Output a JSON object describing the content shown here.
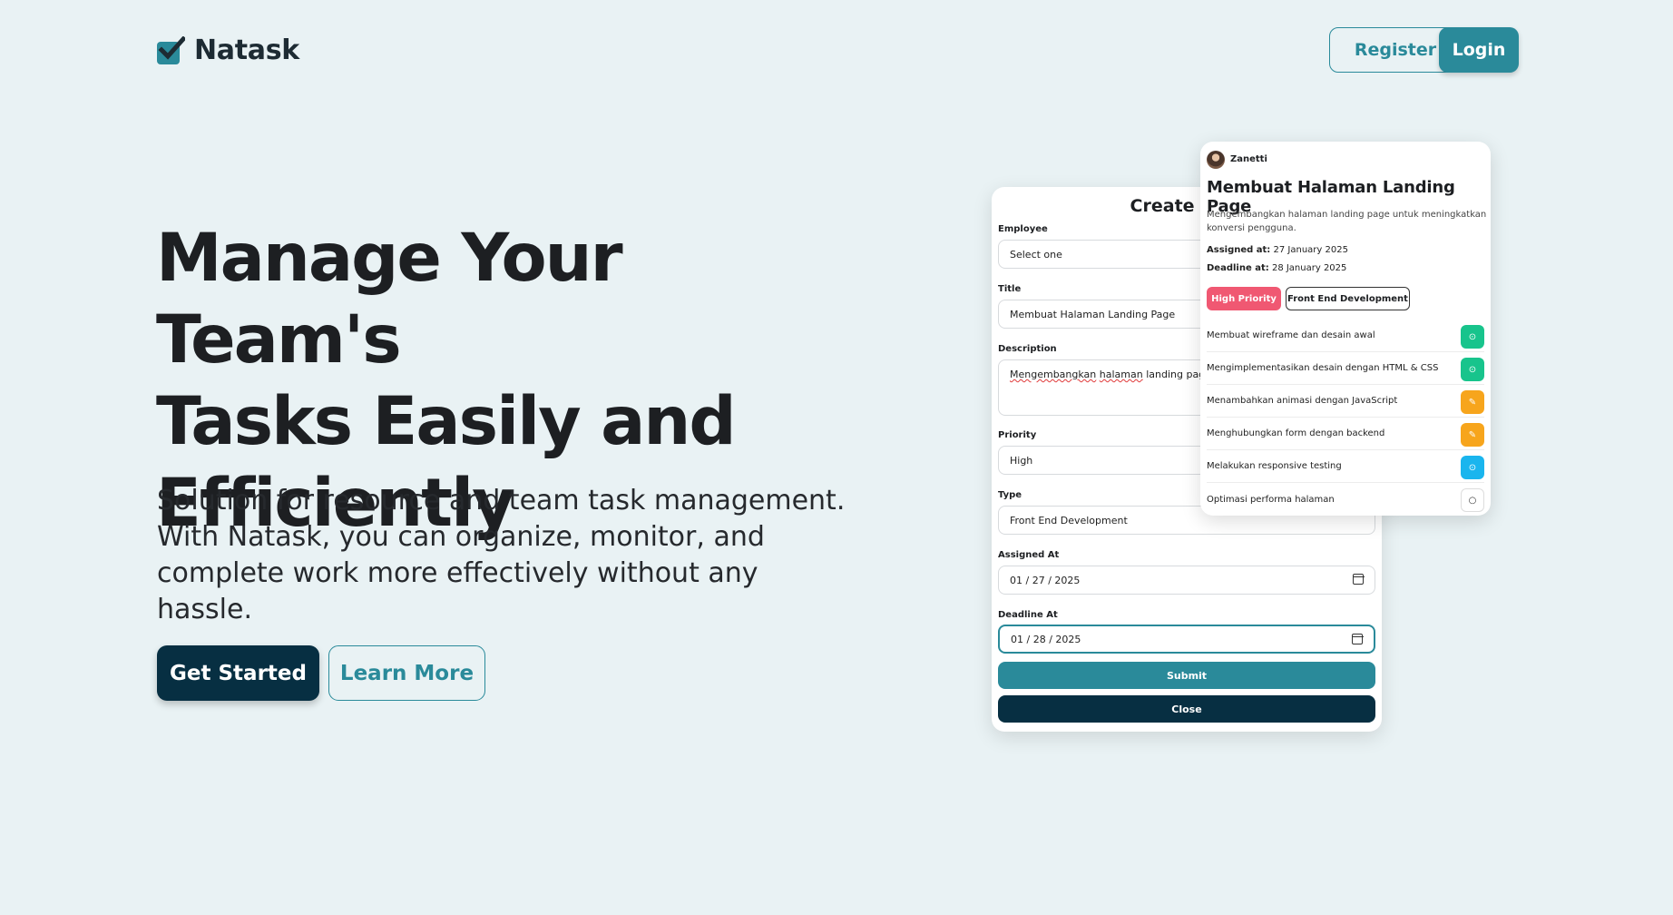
{
  "header": {
    "brand": "Natask",
    "register_label": "Register",
    "login_label": "Login"
  },
  "hero": {
    "title_lines": [
      "Manage Your Team's",
      "Tasks Easily and",
      "Efficiently"
    ],
    "subtitle_lines": [
      "Solution for resource and team task management.",
      "With Natask, you can organize, monitor, and",
      "complete work more effectively without any hassle."
    ],
    "get_started_label": "Get Started",
    "learn_more_label": "Learn More"
  },
  "form": {
    "title": "Create Task",
    "employee_label": "Employee",
    "employee_value": "Select one",
    "title_label": "Title",
    "title_value": "Membuat Halaman Landing Page",
    "description_label": "Description",
    "description_value_part1": "Mengembangkan",
    "description_value_part2": "halaman",
    "description_value_part3": "landing page untuk meningkatkan konversi pengguna.",
    "priority_label": "Priority",
    "priority_value": "High",
    "type_label": "Type",
    "type_value": "Front End Development",
    "assigned_label": "Assigned At",
    "assigned_value": "01 / 27 / 2025",
    "deadline_label": "Deadline At",
    "deadline_value": "01 / 28 / 2025",
    "submit_label": "Submit",
    "close_label": "Close"
  },
  "task": {
    "assignee": "Zanetti",
    "title": "Membuat Halaman Landing Page",
    "description": "Mengembangkan halaman landing page untuk meningkatkan konversi pengguna.",
    "assigned_label": "Assigned at:",
    "assigned_value": "27 January 2025",
    "deadline_label": "Deadline at:",
    "deadline_value": "28 January 2025",
    "priority_badge": "High Priority",
    "type_badge": "Front End Development",
    "subtasks": [
      {
        "label": "Membuat wireframe dan desain awal",
        "status": "done",
        "icon": "check-circle-icon"
      },
      {
        "label": "Mengimplementasikan desain dengan HTML & CSS",
        "status": "done",
        "icon": "check-circle-icon"
      },
      {
        "label": "Menambahkan animasi dengan JavaScript",
        "status": "in-progress",
        "icon": "pencil-icon"
      },
      {
        "label": "Menghubungkan form dengan backend",
        "status": "in-progress",
        "icon": "pencil-icon"
      },
      {
        "label": "Melakukan responsive testing",
        "status": "review",
        "icon": "check-circle-icon"
      },
      {
        "label": "Optimasi performa halaman",
        "status": "todo",
        "icon": "circle-icon"
      }
    ]
  },
  "colors": {
    "background": "#e9f2f4",
    "primary": "#2a8a9a",
    "dark": "#072f42",
    "priority_high": "#f05872",
    "status_done": "#18c48c",
    "status_progress": "#f7a51c",
    "status_review": "#1ab5ee"
  }
}
